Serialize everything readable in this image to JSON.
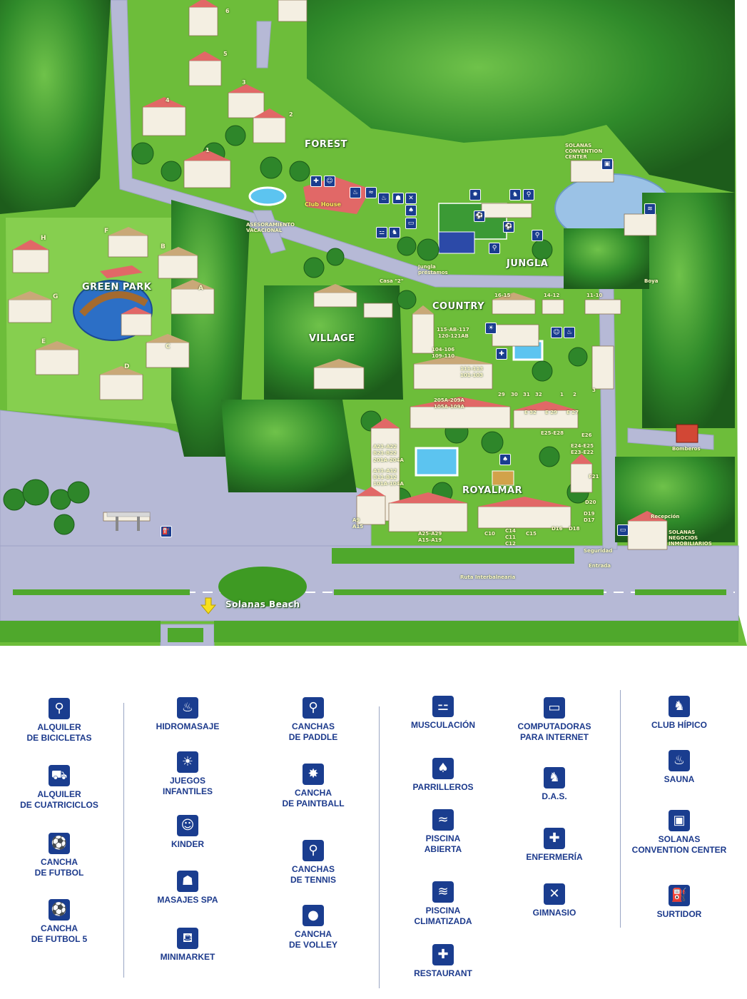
{
  "map": {
    "zones": {
      "forest": "FOREST",
      "green_park": "GREEN PARK",
      "village": "VILLAGE",
      "country": "COUNTRY",
      "jungla": "JUNGLA",
      "royalmar": "ROYALMAR"
    },
    "places": {
      "club_house": "Club House",
      "asesoramiento": [
        "ASESORAMIENTO",
        "VACACIONAL"
      ],
      "convention": [
        "SOLANAS",
        "CONVENTION",
        "CENTER"
      ],
      "jungla_prestamos": [
        "Jungla",
        "préstamos"
      ],
      "bomberos": "Bomberos",
      "recepcion": "Recepción",
      "negocios": [
        "SOLANAS",
        "NEGOCIOS",
        "INMOBILIARIOS"
      ],
      "seguridad": "Seguridad",
      "entrada": "Entrada",
      "ruta": "Ruta Interbalnearia",
      "solanas_beach": "Solanas Beach",
      "boya": "Boya",
      "casa2": "Casa \"2\""
    },
    "green_park_letters": [
      "H",
      "F",
      "B",
      "G",
      "A",
      "E",
      "C",
      "D"
    ],
    "forest_numbers": [
      "6",
      "5",
      "3",
      "4",
      "2",
      "1"
    ],
    "country_labels": [
      "16-15",
      "14-12",
      "11-10",
      "115-AB-117",
      "120-121AB",
      "104-106",
      "109-110",
      "111-113",
      "101-103",
      "29",
      "30",
      "31",
      "32",
      "1",
      "2",
      "3"
    ],
    "royalmar_labels": [
      "205A-209A",
      "105A-109A",
      "E 32",
      "E 29",
      "E 27",
      "E25-E28",
      "E26",
      "E24-E25",
      "E23-E22",
      "E21",
      "A21-A22",
      "B21-B22",
      "201A-204A",
      "A11-A12",
      "B11-B12",
      "101A-104A",
      "A9",
      "A15",
      "A25-A29",
      "A15-A19",
      "C10",
      "C14",
      "C11",
      "C12",
      "C15",
      "D16",
      "D18",
      "D19",
      "D17",
      "D20"
    ]
  },
  "legend": {
    "columns": [
      [
        {
          "icon": "bicycle-icon",
          "glyph": "⚲",
          "lines": [
            "ALQUILER",
            "DE BICICLETAS"
          ]
        },
        {
          "icon": "quad-icon",
          "glyph": "⛟",
          "lines": [
            "ALQUILER",
            "DE CUATRICICLOS"
          ]
        },
        {
          "icon": "soccer-ball-icon",
          "glyph": "⚽",
          "lines": [
            "CANCHA",
            "DE FUTBOL"
          ]
        },
        {
          "icon": "soccer5-icon",
          "glyph": "⚽",
          "lines": [
            "CANCHA",
            "DE FUTBOL 5"
          ]
        }
      ],
      [
        {
          "icon": "hydromassage-icon",
          "glyph": "♨",
          "lines": [
            "HIDROMASAJE"
          ]
        },
        {
          "icon": "playground-icon",
          "glyph": "☀",
          "lines": [
            "JUEGOS",
            "INFANTILES"
          ]
        },
        {
          "icon": "kinder-icon",
          "glyph": "☺",
          "lines": [
            "KINDER"
          ]
        },
        {
          "icon": "massage-spa-icon",
          "glyph": "☗",
          "lines": [
            "MASAJES SPA"
          ]
        },
        {
          "icon": "cart-icon",
          "glyph": "⛾",
          "lines": [
            "MINIMARKET"
          ]
        }
      ],
      [
        {
          "icon": "paddle-icon",
          "glyph": "⚲",
          "lines": [
            "CANCHAS",
            "DE PADDLE"
          ]
        },
        {
          "icon": "paintball-icon",
          "glyph": "✸",
          "lines": [
            "CANCHA",
            "DE PAINTBALL"
          ]
        },
        {
          "icon": "tennis-icon",
          "glyph": "⚲",
          "lines": [
            "CANCHAS",
            "DE TENNIS"
          ]
        },
        {
          "icon": "volley-icon",
          "glyph": "●",
          "lines": [
            "CANCHA",
            "DE VOLLEY"
          ]
        }
      ],
      [
        {
          "icon": "dumbbell-icon",
          "glyph": "⚍",
          "lines": [
            "MUSCULACIÓN"
          ]
        },
        {
          "icon": "grill-icon",
          "glyph": "♠",
          "lines": [
            "PARRILLEROS"
          ]
        },
        {
          "icon": "pool-open-icon",
          "glyph": "≈",
          "lines": [
            "PISCINA",
            "ABIERTA"
          ]
        },
        {
          "icon": "pool-heated-icon",
          "glyph": "≋",
          "lines": [
            "PISCINA",
            "CLIMATIZADA"
          ]
        },
        {
          "icon": "restaurant-icon",
          "glyph": "✚",
          "lines": [
            "RESTAURANT"
          ]
        }
      ],
      [
        {
          "icon": "computer-icon",
          "glyph": "▭",
          "lines": [
            "COMPUTADORAS",
            "PARA INTERNET"
          ]
        },
        {
          "icon": "das-icon",
          "glyph": "♞",
          "lines": [
            "D.A.S."
          ]
        },
        {
          "icon": "nursing-cross-icon",
          "glyph": "✚",
          "lines": [
            "ENFERMERÍA"
          ]
        },
        {
          "icon": "gym-icon",
          "glyph": "✕",
          "lines": [
            "GIMNASIO"
          ]
        }
      ],
      [
        {
          "icon": "horse-icon",
          "glyph": "♞",
          "lines": [
            "CLUB HÍPICO"
          ]
        },
        {
          "icon": "sauna-icon",
          "glyph": "♨",
          "lines": [
            "SAUNA"
          ]
        },
        {
          "icon": "convention-icon",
          "glyph": "▣",
          "lines": [
            "SOLANAS",
            "CONVENTION CENTER"
          ]
        },
        {
          "icon": "fuel-pump-icon",
          "glyph": "⛽",
          "lines": [
            "SURTIDOR"
          ]
        }
      ]
    ]
  }
}
